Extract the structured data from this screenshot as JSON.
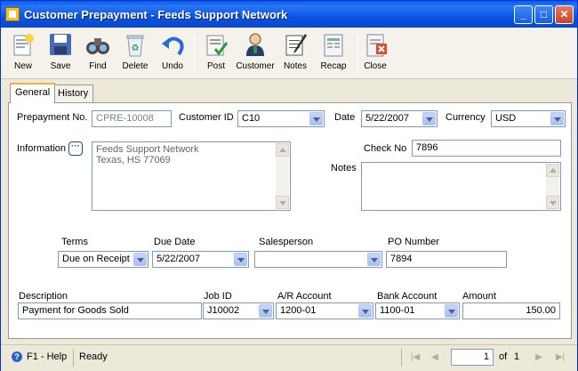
{
  "window": {
    "title": "Customer Prepayment - Feeds Support Network"
  },
  "toolbar": {
    "new": "New",
    "save": "Save",
    "find": "Find",
    "delete": "Delete",
    "undo": "Undo",
    "post": "Post",
    "customer": "Customer",
    "notes": "Notes",
    "recap": "Recap",
    "close": "Close"
  },
  "tabs": [
    "General",
    "History"
  ],
  "form": {
    "prepayment_no_label": "Prepayment No.",
    "prepayment_no": "CPRE-10008",
    "customer_id_label": "Customer ID",
    "customer_id": "C10",
    "date_label": "Date",
    "date": "5/22/2007",
    "currency_label": "Currency",
    "currency": "USD",
    "information_label": "Information",
    "information_line1": "Feeds Support Network",
    "information_line2": "Texas, HS 77069",
    "check_no_label": "Check No",
    "check_no": "7896",
    "notes_label": "Notes",
    "notes": "",
    "terms_label": "Terms",
    "terms": "Due on Receipt",
    "due_date_label": "Due Date",
    "due_date": "5/22/2007",
    "salesperson_label": "Salesperson",
    "salesperson": "",
    "po_number_label": "PO Number",
    "po_number": "7894",
    "description_label": "Description",
    "description": "Payment for Goods Sold",
    "job_id_label": "Job ID",
    "job_id": "J10002",
    "ar_account_label": "A/R Account",
    "ar_account": "1200-01",
    "bank_account_label": "Bank Account",
    "bank_account": "1100-01",
    "amount_label": "Amount",
    "amount": "150.00"
  },
  "status": {
    "help": "F1 - Help",
    "state": "Ready",
    "page": "1",
    "of": "of",
    "total": "1"
  }
}
